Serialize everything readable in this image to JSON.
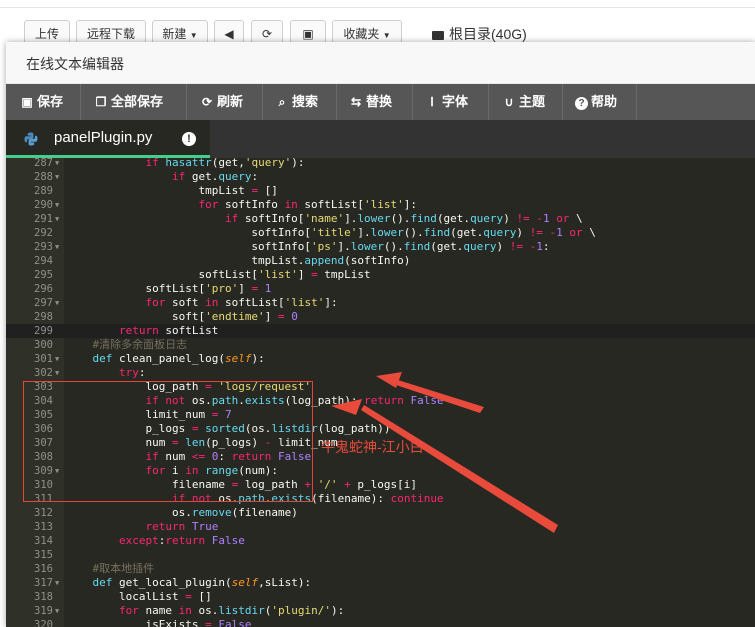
{
  "file_manager_toolbar": {
    "upload": "上传",
    "remote_download": "远程下载",
    "new": "新建",
    "favorites": "收藏夹",
    "root_dir": "根目录(40G)"
  },
  "dialog": {
    "title": "在线文本编辑器",
    "toolbar": [
      {
        "label": "保存",
        "icon": "save-icon"
      },
      {
        "label": "全部保存",
        "icon": "save-all-icon"
      },
      {
        "label": "刷新",
        "icon": "refresh-icon"
      },
      {
        "label": "搜索",
        "icon": "search-icon"
      },
      {
        "label": "替换",
        "icon": "replace-icon"
      },
      {
        "label": "字体",
        "icon": "font-icon"
      },
      {
        "label": "主题",
        "icon": "theme-icon"
      },
      {
        "label": "帮助",
        "icon": "help-icon"
      }
    ],
    "tab": {
      "filename": "panelPlugin.py",
      "icon": "python-icon"
    }
  },
  "code_lines": [
    {
      "n": "287",
      "fold": true,
      "tokens": [
        [
          "",
          "            "
        ],
        [
          "k",
          "if"
        ],
        [
          "",
          " "
        ],
        [
          "f",
          "hasattr"
        ],
        [
          "",
          "(get,"
        ],
        [
          "s",
          "'query'"
        ],
        [
          "",
          "):"
        ]
      ]
    },
    {
      "n": "288",
      "fold": true,
      "tokens": [
        [
          "",
          "                "
        ],
        [
          "k",
          "if"
        ],
        [
          "",
          " get."
        ],
        [
          "f",
          "query"
        ],
        [
          "",
          ":"
        ]
      ]
    },
    {
      "n": "289",
      "fold": false,
      "tokens": [
        [
          "",
          "                    tmpList "
        ],
        [
          "k",
          "="
        ],
        [
          "",
          " []"
        ]
      ]
    },
    {
      "n": "290",
      "fold": true,
      "tokens": [
        [
          "",
          "                    "
        ],
        [
          "k",
          "for"
        ],
        [
          "",
          " softInfo "
        ],
        [
          "k",
          "in"
        ],
        [
          "",
          " softList["
        ],
        [
          "s",
          "'list'"
        ],
        [
          "",
          "]:"
        ]
      ]
    },
    {
      "n": "291",
      "fold": true,
      "tokens": [
        [
          "",
          "                        "
        ],
        [
          "k",
          "if"
        ],
        [
          "",
          " softInfo["
        ],
        [
          "s",
          "'name'"
        ],
        [
          "",
          "]."
        ],
        [
          "f",
          "lower"
        ],
        [
          "",
          "()."
        ],
        [
          "f",
          "find"
        ],
        [
          "",
          "(get."
        ],
        [
          "f",
          "query"
        ],
        [
          "",
          ") "
        ],
        [
          "k",
          "!="
        ],
        [
          "",
          " "
        ],
        [
          "k",
          "-"
        ],
        [
          "n",
          "1"
        ],
        [
          "",
          " "
        ],
        [
          "k",
          "or"
        ],
        [
          "",
          " \\"
        ]
      ]
    },
    {
      "n": "292",
      "fold": false,
      "tokens": [
        [
          "",
          "                            softInfo["
        ],
        [
          "s",
          "'title'"
        ],
        [
          "",
          "]."
        ],
        [
          "f",
          "lower"
        ],
        [
          "",
          "()."
        ],
        [
          "f",
          "find"
        ],
        [
          "",
          "(get."
        ],
        [
          "f",
          "query"
        ],
        [
          "",
          ") "
        ],
        [
          "k",
          "!="
        ],
        [
          "",
          " "
        ],
        [
          "k",
          "-"
        ],
        [
          "n",
          "1"
        ],
        [
          "",
          " "
        ],
        [
          "k",
          "or"
        ],
        [
          "",
          " \\"
        ]
      ]
    },
    {
      "n": "293",
      "fold": true,
      "tokens": [
        [
          "",
          "                            softInfo["
        ],
        [
          "s",
          "'ps'"
        ],
        [
          "",
          "]."
        ],
        [
          "f",
          "lower"
        ],
        [
          "",
          "()."
        ],
        [
          "f",
          "find"
        ],
        [
          "",
          "(get."
        ],
        [
          "f",
          "query"
        ],
        [
          "",
          ") "
        ],
        [
          "k",
          "!="
        ],
        [
          "",
          " "
        ],
        [
          "k",
          "-"
        ],
        [
          "n",
          "1"
        ],
        [
          "",
          ":"
        ]
      ]
    },
    {
      "n": "294",
      "fold": false,
      "tokens": [
        [
          "",
          "                            tmpList."
        ],
        [
          "f",
          "append"
        ],
        [
          "",
          "(softInfo)"
        ]
      ]
    },
    {
      "n": "295",
      "fold": false,
      "tokens": [
        [
          "",
          "                    softList["
        ],
        [
          "s",
          "'list'"
        ],
        [
          "",
          "] "
        ],
        [
          "k",
          "="
        ],
        [
          "",
          " tmpList"
        ]
      ]
    },
    {
      "n": "296",
      "fold": false,
      "tokens": [
        [
          "",
          "            softList["
        ],
        [
          "s",
          "'pro'"
        ],
        [
          "",
          "] "
        ],
        [
          "k",
          "="
        ],
        [
          "",
          " "
        ],
        [
          "n",
          "1"
        ]
      ]
    },
    {
      "n": "297",
      "fold": true,
      "tokens": [
        [
          "",
          "            "
        ],
        [
          "k",
          "for"
        ],
        [
          "",
          " soft "
        ],
        [
          "k",
          "in"
        ],
        [
          "",
          " softList["
        ],
        [
          "s",
          "'list'"
        ],
        [
          "",
          "]:"
        ]
      ]
    },
    {
      "n": "298",
      "fold": false,
      "tokens": [
        [
          "",
          "                soft["
        ],
        [
          "s",
          "'endtime'"
        ],
        [
          "",
          "] "
        ],
        [
          "k",
          "="
        ],
        [
          "",
          " "
        ],
        [
          "n",
          "0"
        ]
      ]
    },
    {
      "n": "299",
      "fold": false,
      "tokens": [
        [
          "",
          "        "
        ],
        [
          "k",
          "return"
        ],
        [
          "",
          " softList"
        ]
      ],
      "active": true
    },
    {
      "n": "300",
      "fold": false,
      "tokens": [
        [
          "c",
          "    #清除多余面板日志"
        ]
      ]
    },
    {
      "n": "301",
      "fold": true,
      "tokens": [
        [
          "",
          "    "
        ],
        [
          "f",
          "def"
        ],
        [
          "",
          " clean_panel_log("
        ],
        [
          "p",
          "self"
        ],
        [
          "",
          "):"
        ]
      ]
    },
    {
      "n": "302",
      "fold": true,
      "tokens": [
        [
          "",
          "        "
        ],
        [
          "k",
          "try"
        ],
        [
          "",
          ":"
        ]
      ]
    },
    {
      "n": "303",
      "fold": false,
      "tokens": [
        [
          "",
          "            log_path "
        ],
        [
          "k",
          "="
        ],
        [
          "",
          " "
        ],
        [
          "s",
          "'logs/request'"
        ]
      ]
    },
    {
      "n": "304",
      "fold": false,
      "tokens": [
        [
          "",
          "            "
        ],
        [
          "k",
          "if not"
        ],
        [
          "",
          " os."
        ],
        [
          "f",
          "path"
        ],
        [
          "",
          "."
        ],
        [
          "f",
          "exists"
        ],
        [
          "",
          "(log_path): "
        ],
        [
          "k",
          "return"
        ],
        [
          "",
          " "
        ],
        [
          "n",
          "False"
        ]
      ]
    },
    {
      "n": "305",
      "fold": false,
      "tokens": [
        [
          "",
          "            limit_num "
        ],
        [
          "k",
          "="
        ],
        [
          "",
          " "
        ],
        [
          "n",
          "7"
        ]
      ]
    },
    {
      "n": "306",
      "fold": false,
      "tokens": [
        [
          "",
          "            p_logs "
        ],
        [
          "k",
          "="
        ],
        [
          "",
          " "
        ],
        [
          "f",
          "sorted"
        ],
        [
          "",
          "(os."
        ],
        [
          "f",
          "listdir"
        ],
        [
          "",
          "(log_path))"
        ]
      ]
    },
    {
      "n": "307",
      "fold": false,
      "tokens": [
        [
          "",
          "            num "
        ],
        [
          "k",
          "="
        ],
        [
          "",
          " "
        ],
        [
          "f",
          "len"
        ],
        [
          "",
          "(p_logs) "
        ],
        [
          "k",
          "-"
        ],
        [
          "",
          " limit_num"
        ]
      ]
    },
    {
      "n": "308",
      "fold": false,
      "tokens": [
        [
          "",
          "            "
        ],
        [
          "k",
          "if"
        ],
        [
          "",
          " num "
        ],
        [
          "k",
          "<="
        ],
        [
          "",
          " "
        ],
        [
          "n",
          "0"
        ],
        [
          "",
          ": "
        ],
        [
          "k",
          "return"
        ],
        [
          "",
          " "
        ],
        [
          "n",
          "False"
        ]
      ]
    },
    {
      "n": "309",
      "fold": true,
      "tokens": [
        [
          "",
          "            "
        ],
        [
          "k",
          "for"
        ],
        [
          "",
          " i "
        ],
        [
          "k",
          "in"
        ],
        [
          "",
          " "
        ],
        [
          "f",
          "range"
        ],
        [
          "",
          "(num):"
        ]
      ]
    },
    {
      "n": "310",
      "fold": false,
      "tokens": [
        [
          "",
          "                filename "
        ],
        [
          "k",
          "="
        ],
        [
          "",
          " log_path "
        ],
        [
          "k",
          "+"
        ],
        [
          "",
          " "
        ],
        [
          "s",
          "'/'"
        ],
        [
          "",
          " "
        ],
        [
          "k",
          "+"
        ],
        [
          "",
          " p_logs[i]"
        ]
      ]
    },
    {
      "n": "311",
      "fold": false,
      "tokens": [
        [
          "",
          "                "
        ],
        [
          "k",
          "if not"
        ],
        [
          "",
          " os."
        ],
        [
          "f",
          "path"
        ],
        [
          "",
          "."
        ],
        [
          "f",
          "exists"
        ],
        [
          "",
          "(filename): "
        ],
        [
          "k",
          "continue"
        ]
      ]
    },
    {
      "n": "312",
      "fold": false,
      "tokens": [
        [
          "",
          "                os."
        ],
        [
          "f",
          "remove"
        ],
        [
          "",
          "(filename)"
        ]
      ]
    },
    {
      "n": "313",
      "fold": false,
      "tokens": [
        [
          "",
          "            "
        ],
        [
          "k",
          "return"
        ],
        [
          "",
          " "
        ],
        [
          "n",
          "True"
        ]
      ]
    },
    {
      "n": "314",
      "fold": false,
      "tokens": [
        [
          "",
          "        "
        ],
        [
          "k",
          "except"
        ],
        [
          "",
          ":"
        ],
        [
          "k",
          "return"
        ],
        [
          "",
          " "
        ],
        [
          "n",
          "False"
        ]
      ]
    },
    {
      "n": "315",
      "fold": false,
      "tokens": []
    },
    {
      "n": "316",
      "fold": false,
      "tokens": [
        [
          "c",
          "    #取本地插件"
        ]
      ]
    },
    {
      "n": "317",
      "fold": true,
      "tokens": [
        [
          "",
          "    "
        ],
        [
          "f",
          "def"
        ],
        [
          "",
          " get_local_plugin("
        ],
        [
          "p",
          "self"
        ],
        [
          "",
          ",sList):"
        ]
      ]
    },
    {
      "n": "318",
      "fold": false,
      "tokens": [
        [
          "",
          "        localList "
        ],
        [
          "k",
          "="
        ],
        [
          "",
          " []"
        ]
      ]
    },
    {
      "n": "319",
      "fold": true,
      "tokens": [
        [
          "",
          "        "
        ],
        [
          "k",
          "for"
        ],
        [
          "",
          " name "
        ],
        [
          "k",
          "in"
        ],
        [
          "",
          " os."
        ],
        [
          "f",
          "listdir"
        ],
        [
          "",
          "("
        ],
        [
          "s",
          "'plugin/'"
        ],
        [
          "",
          "):"
        ]
      ]
    },
    {
      "n": "320",
      "fold": false,
      "tokens": [
        [
          "",
          "            isExists "
        ],
        [
          "k",
          "="
        ],
        [
          "",
          " "
        ],
        [
          "n",
          "False"
        ]
      ]
    }
  ],
  "annotation": {
    "text": "牛鬼蛇神-江小白",
    "color": "#e84a3c"
  },
  "colors": {
    "toolbar_bg": "#565656",
    "editor_bg": "#272822",
    "tab_accent": "#43d08a"
  }
}
